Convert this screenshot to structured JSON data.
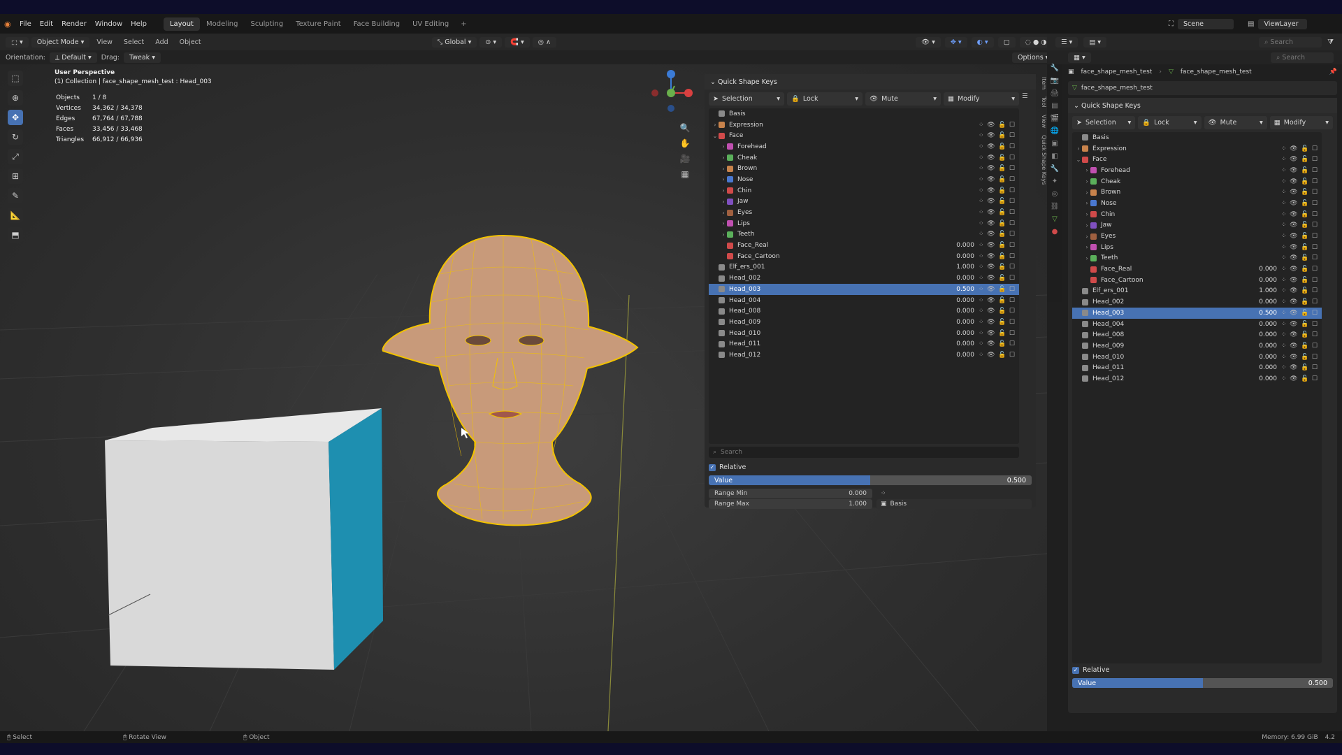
{
  "menu": [
    "File",
    "Edit",
    "Render",
    "Window",
    "Help"
  ],
  "workspaces": [
    {
      "label": "Layout",
      "active": true
    },
    {
      "label": "Modeling",
      "active": false
    },
    {
      "label": "Sculpting",
      "active": false
    },
    {
      "label": "Texture Paint",
      "active": false
    },
    {
      "label": "Face Building",
      "active": false
    },
    {
      "label": "UV Editing",
      "active": false
    }
  ],
  "scene": {
    "scene_label": "Scene",
    "viewlayer_label": "ViewLayer"
  },
  "header": {
    "mode": "Object Mode",
    "menus": [
      "View",
      "Select",
      "Add",
      "Object"
    ],
    "transform": "Global",
    "options": "Options"
  },
  "tool_settings": {
    "orientation_label": "Orientation:",
    "orientation_value": "Default",
    "drag_label": "Drag:",
    "drag_value": "Tweak"
  },
  "viewport": {
    "perspective": "User Perspective",
    "collection": "(1) Collection | face_shape_mesh_test : Head_003",
    "stats": [
      {
        "k": "Objects",
        "v": "1 / 8"
      },
      {
        "k": "Vertices",
        "v": "34,362 / 34,378"
      },
      {
        "k": "Edges",
        "v": "67,764 / 67,788"
      },
      {
        "k": "Faces",
        "v": "33,456 / 33,468"
      },
      {
        "k": "Triangles",
        "v": "66,912 / 66,936"
      }
    ]
  },
  "qsk": {
    "title": "Quick Shape Keys",
    "selection": "Selection",
    "lock": "Lock",
    "mute": "Mute",
    "modify": "Modify",
    "search_placeholder": "Search",
    "relative": "Relative",
    "value_label": "Value",
    "value": "0.500",
    "value_fraction": 0.5,
    "range_min_label": "Range Min",
    "range_min": "0.000",
    "range_max_label": "Range Max",
    "range_max": "1.000",
    "basis": "Basis",
    "keys": [
      {
        "name": "Basis",
        "level": 0,
        "caret": "",
        "color": "#8a8a8a",
        "value": "",
        "sel": false,
        "ctl": false
      },
      {
        "name": "Expression",
        "level": 0,
        "caret": "›",
        "color": "#c8834c",
        "value": "",
        "sel": false,
        "ctl": true
      },
      {
        "name": "Face",
        "level": 0,
        "caret": "⌄",
        "color": "#d04a4a",
        "value": "",
        "sel": false,
        "ctl": true
      },
      {
        "name": "Forehead",
        "level": 1,
        "caret": "›",
        "color": "#c050b0",
        "value": "",
        "sel": false,
        "ctl": true
      },
      {
        "name": "Cheak",
        "level": 1,
        "caret": "›",
        "color": "#5bb05b",
        "value": "",
        "sel": false,
        "ctl": true
      },
      {
        "name": "Brown",
        "level": 1,
        "caret": "›",
        "color": "#c8834c",
        "value": "",
        "sel": false,
        "ctl": true
      },
      {
        "name": "Nose",
        "level": 1,
        "caret": "›",
        "color": "#4a78d0",
        "value": "",
        "sel": false,
        "ctl": true
      },
      {
        "name": "Chin",
        "level": 1,
        "caret": "›",
        "color": "#d04a4a",
        "value": "",
        "sel": false,
        "ctl": true
      },
      {
        "name": "Jaw",
        "level": 1,
        "caret": "›",
        "color": "#8050c0",
        "value": "",
        "sel": false,
        "ctl": true
      },
      {
        "name": "Eyes",
        "level": 1,
        "caret": "›",
        "color": "#a06040",
        "value": "",
        "sel": false,
        "ctl": true
      },
      {
        "name": "Lips",
        "level": 1,
        "caret": "›",
        "color": "#c050b0",
        "value": "",
        "sel": false,
        "ctl": true
      },
      {
        "name": "Teeth",
        "level": 1,
        "caret": "›",
        "color": "#5bb05b",
        "value": "",
        "sel": false,
        "ctl": true
      },
      {
        "name": "Face_Real",
        "level": 1,
        "caret": "",
        "color": "#d04a4a",
        "value": "0.000",
        "sel": false,
        "ctl": true
      },
      {
        "name": "Face_Cartoon",
        "level": 1,
        "caret": "",
        "color": "#d04a4a",
        "value": "0.000",
        "sel": false,
        "ctl": true
      },
      {
        "name": "Elf_ers_001",
        "level": 0,
        "caret": "",
        "color": "#8a8a8a",
        "value": "1.000",
        "sel": false,
        "ctl": true
      },
      {
        "name": "Head_002",
        "level": 0,
        "caret": "",
        "color": "#8a8a8a",
        "value": "0.000",
        "sel": false,
        "ctl": true
      },
      {
        "name": "Head_003",
        "level": 0,
        "caret": "",
        "color": "#8a8a8a",
        "value": "0.500",
        "sel": true,
        "ctl": true
      },
      {
        "name": "Head_004",
        "level": 0,
        "caret": "",
        "color": "#8a8a8a",
        "value": "0.000",
        "sel": false,
        "ctl": true
      },
      {
        "name": "Head_008",
        "level": 0,
        "caret": "",
        "color": "#8a8a8a",
        "value": "0.000",
        "sel": false,
        "ctl": true
      },
      {
        "name": "Head_009",
        "level": 0,
        "caret": "",
        "color": "#8a8a8a",
        "value": "0.000",
        "sel": false,
        "ctl": true
      },
      {
        "name": "Head_010",
        "level": 0,
        "caret": "",
        "color": "#8a8a8a",
        "value": "0.000",
        "sel": false,
        "ctl": true
      },
      {
        "name": "Head_011",
        "level": 0,
        "caret": "",
        "color": "#8a8a8a",
        "value": "0.000",
        "sel": false,
        "ctl": true
      },
      {
        "name": "Head_012",
        "level": 0,
        "caret": "",
        "color": "#8a8a8a",
        "value": "0.000",
        "sel": false,
        "ctl": true
      }
    ]
  },
  "properties": {
    "breadcrumb_object": "face_shape_mesh_test",
    "breadcrumb_data": "face_shape_mesh_test",
    "mesh_name": "face_shape_mesh_test",
    "search_placeholder": "Search"
  },
  "sidebar_tabs": [
    "Item",
    "Tool",
    "View",
    "Quick Shape Keys"
  ],
  "status": {
    "select": "Select",
    "rotate": "Rotate View",
    "object": "Object",
    "memory": "Memory: 6.99 GiB",
    "version": "4.2"
  },
  "colors": {
    "accent": "#4772b3",
    "wire": "#f2c200",
    "cube_side": "#1e8fb0"
  }
}
